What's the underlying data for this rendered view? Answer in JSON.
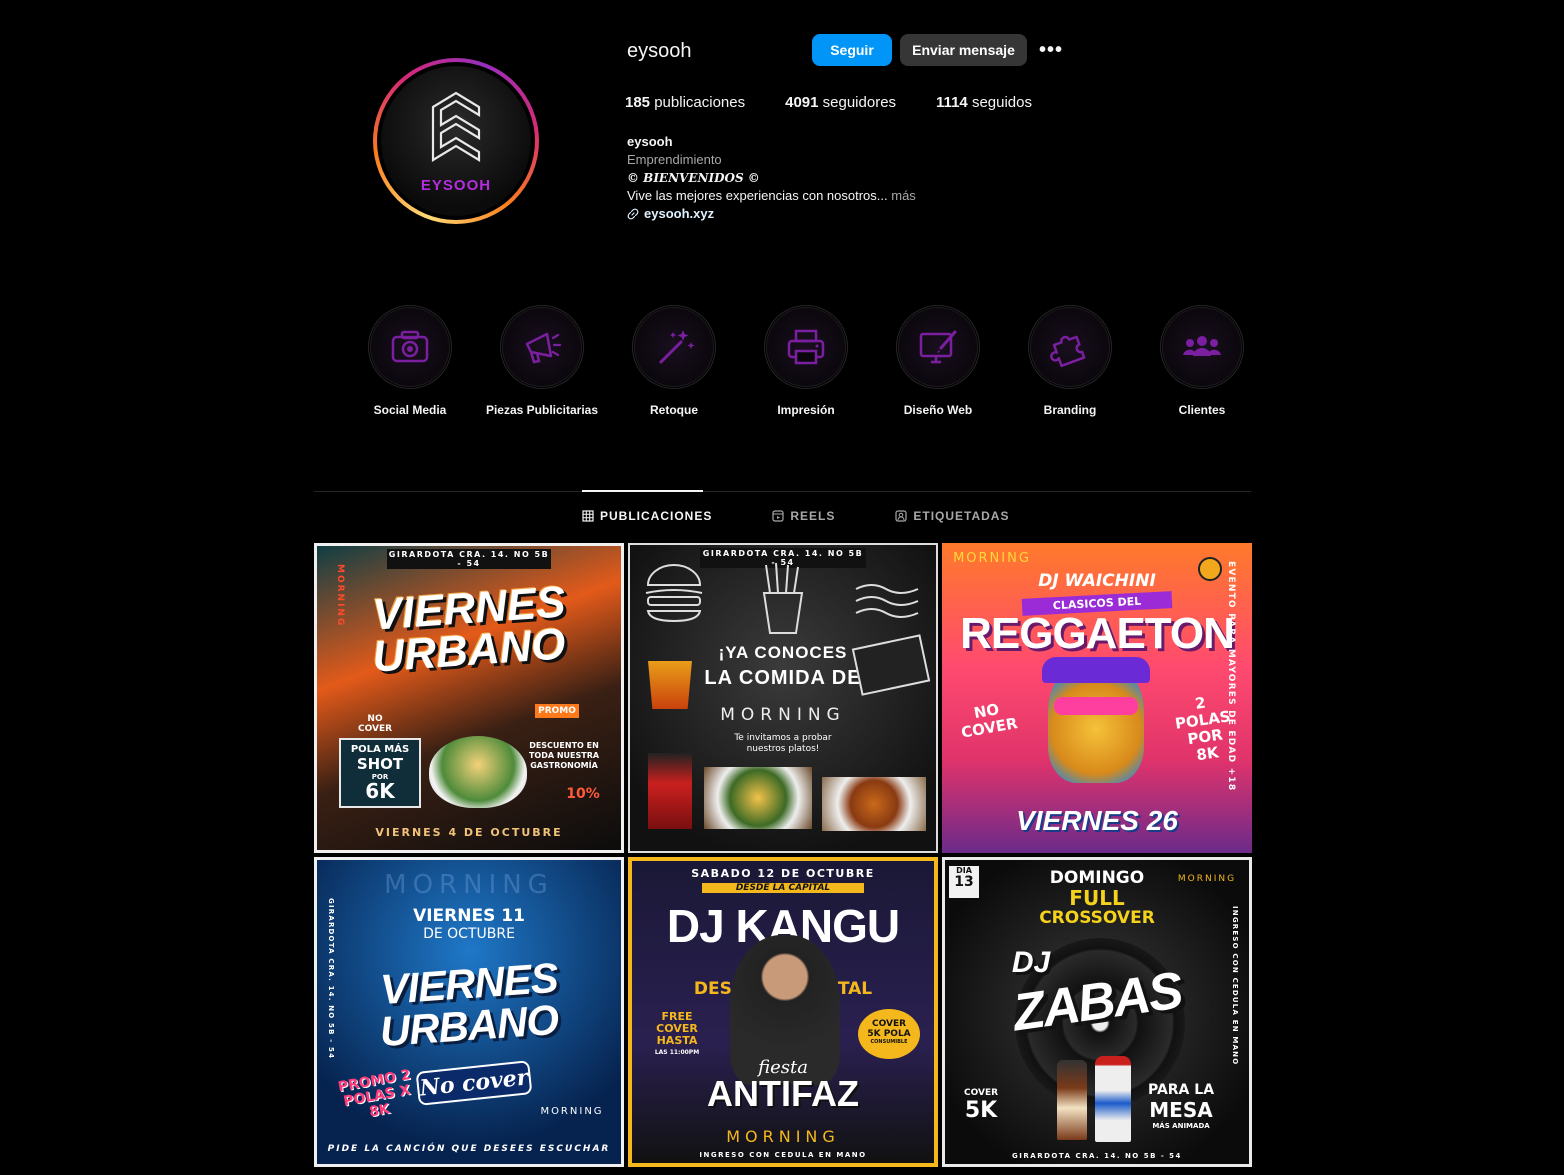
{
  "profile": {
    "username": "eysooh",
    "avatar_text": "EYSOOH",
    "follow_label": "Seguir",
    "message_label": "Enviar mensaje",
    "more_label": "•••",
    "stats": {
      "posts_count": "185",
      "posts_label": "publicaciones",
      "followers_count": "4091",
      "followers_label": "seguidores",
      "following_count": "1114",
      "following_label": "seguidos"
    },
    "bio": {
      "name": "eysooh",
      "category": "Emprendimiento",
      "welcome": "© BIENVENIDOS ©",
      "text": "Vive las mejores experiencias con nosotros...",
      "more": "más",
      "link": "eysooh.xyz"
    }
  },
  "highlights": [
    {
      "label": "Social Media",
      "icon": "camera-icon"
    },
    {
      "label": "Piezas Publicitarias",
      "icon": "megaphone-icon"
    },
    {
      "label": "Retoque",
      "icon": "magic-wand-icon"
    },
    {
      "label": "Impresión",
      "icon": "printer-icon"
    },
    {
      "label": "Diseño Web",
      "icon": "web-design-icon"
    },
    {
      "label": "Branding",
      "icon": "puzzle-icon"
    },
    {
      "label": "Clientes",
      "icon": "users-icon"
    }
  ],
  "tabs": [
    {
      "label": "PUBLICACIONES",
      "icon": "grid-icon",
      "active": true
    },
    {
      "label": "REELS",
      "icon": "reels-icon",
      "active": false
    },
    {
      "label": "ETIQUETADAS",
      "icon": "tagged-icon",
      "active": false
    }
  ],
  "posts": {
    "p1": {
      "address": "GIRARDOTA CRA. 14. NO 5B - 54",
      "title1": "VIERNES",
      "title2": "URBANO",
      "no_cover": "NO COVER",
      "promo": "PROMO",
      "deal1": "POLA MÁS",
      "deal2": "SHOT",
      "deal3": "POR",
      "deal4": "6K",
      "discount": "DESCUENTO EN TODA NUESTRA GASTRONOMÍA",
      "discount_pct": "10%",
      "date": "VIERNES 4 DE OCTUBRE",
      "brand": "MORNING"
    },
    "p2": {
      "address": "GIRARDOTA CRA. 14. NO 5B - 54",
      "line1": "¡YA CONOCES",
      "line2": "LA COMIDA DE",
      "brand": "MORNING",
      "sub": "Te invitamos a probar nuestros platos!"
    },
    "p3": {
      "brand": "MORNING",
      "dj": "DJ WAICHINI",
      "clasicos": "CLASICOS DEL",
      "title": "REGGAETON",
      "no_cover": "NO COVER",
      "deal": "2 POLAS POR 8K",
      "day": "VIERNES 26",
      "side": "EVENTO PARA MAYORES DE EDAD +18"
    },
    "p4": {
      "brand": "MORNING",
      "date1": "VIERNES 11",
      "date2": "DE OCTUBRE",
      "title1": "VIERNES",
      "title2": "URBANO",
      "no_cover": "No cover",
      "promo": "PROMO 2 POLAS X 8K",
      "footer": "PIDE LA CANCIÓN QUE DESEES ESCUCHAR",
      "side": "GIRARDOTA CRA. 14. NO 5B - 54"
    },
    "p5": {
      "date": "SABADO 12 DE OCTUBRE",
      "desde": "DESDE LA CAPITAL",
      "title": "DJ KANGU",
      "sub": "DESDE LA CAPITAL",
      "free": "FREE COVER HASTA",
      "free_time": "LAS 11:00PM",
      "cover": "COVER 5K POLA",
      "cover_sub": "CONSUMIBLE",
      "fiesta": "fiesta",
      "antifaz": "ANTIFAZ",
      "brand": "MORNING",
      "footer": "INGRESO CON CEDULA EN MANO"
    },
    "p6": {
      "dia": "DIA",
      "dia_num": "13",
      "brand": "MORNING",
      "domingo": "DOMINGO",
      "full": "FULL",
      "crossover": "CROSSOVER",
      "dj": "DJ",
      "name": "ZABAS",
      "cover": "COVER",
      "cover_val": "5K",
      "para1": "PARA LA",
      "para2": "MESA",
      "para3": "MÁS ANIMADA",
      "side": "INGRESO CON CEDULA EN MANO",
      "address": "GIRARDOTA CRA. 14. NO 5B - 54"
    }
  },
  "colors": {
    "follow_button": "#0095f6",
    "message_button": "#363636",
    "highlight_icon": "#7a1fa0",
    "background": "#000000"
  }
}
